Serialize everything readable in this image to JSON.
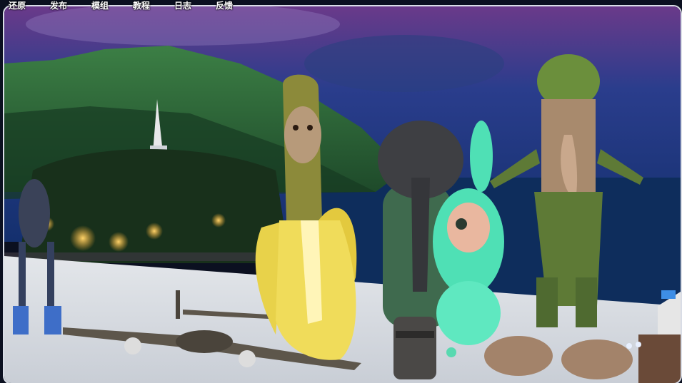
{
  "menu": {
    "items": [
      {
        "id": "restore",
        "label": "还原"
      },
      {
        "id": "publish",
        "label": "发布"
      },
      {
        "id": "modules",
        "label": "模组"
      },
      {
        "id": "tutorial",
        "label": "教程"
      },
      {
        "id": "log",
        "label": "日志"
      },
      {
        "id": "feedback",
        "label": "反馈"
      }
    ]
  },
  "scene": {
    "sky_top": "#1b2a66",
    "sky_mid": "#2b3f8e",
    "mountain": "#2f6b3b",
    "sea": "#0d2a55",
    "floor": "#d7dbe0",
    "banana": "#e8d24a",
    "monkey_fur": "#8c8a3a",
    "elephant": "#3e3f43",
    "cactus": "#3f6a4e",
    "bunny": "#4fe0b5",
    "tree_moss": "#5e7a36",
    "tree_skin": "#a88a6d",
    "plane": "#5d564b",
    "robot": "#3a4258"
  }
}
